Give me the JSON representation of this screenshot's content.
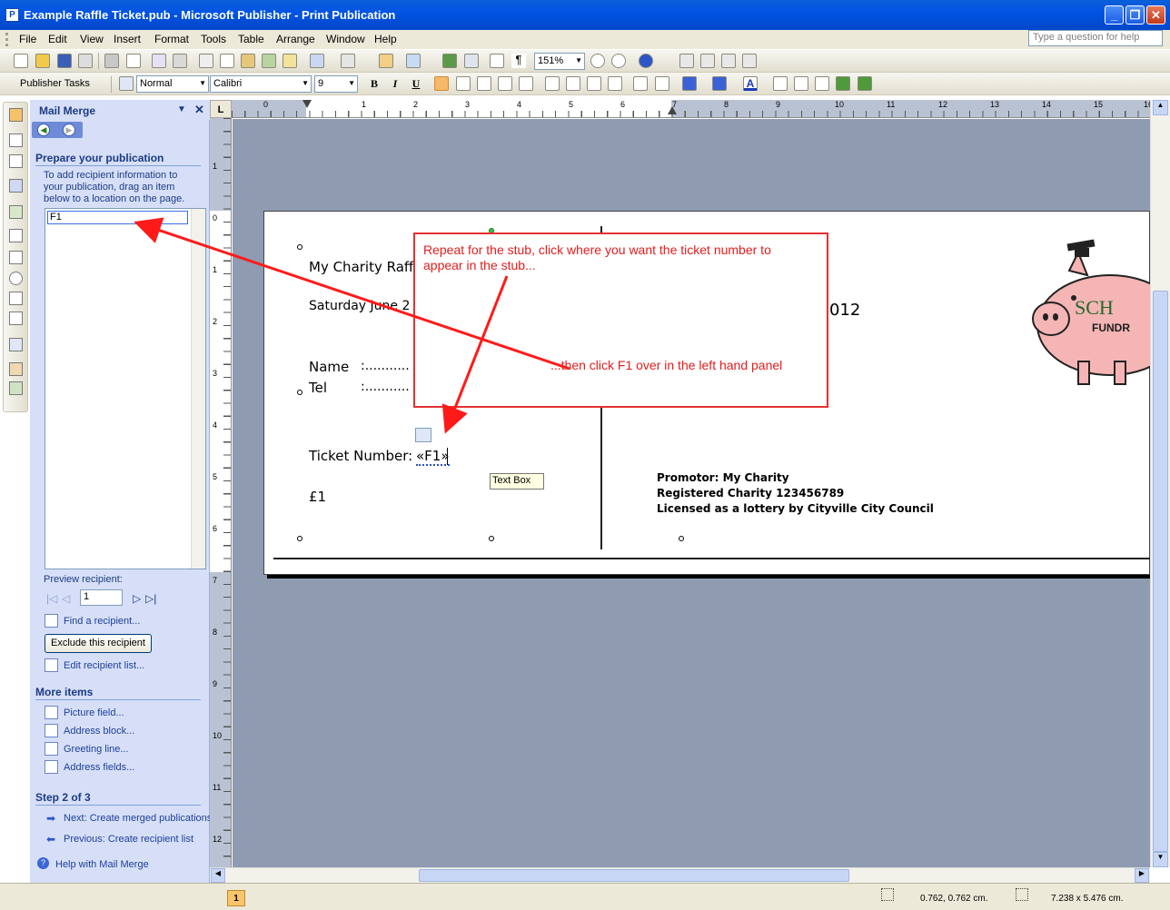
{
  "window": {
    "title": "Example Raffle Ticket.pub - Microsoft Publisher - Print Publication"
  },
  "menu": [
    "File",
    "Edit",
    "View",
    "Insert",
    "Format",
    "Tools",
    "Table",
    "Arrange",
    "Window",
    "Help"
  ],
  "ask_placeholder": "Type a question for help",
  "toolbar": {
    "zoom": "151%",
    "publisher_tasks": "Publisher Tasks",
    "style": "Normal",
    "font": "Calibri",
    "size": "9"
  },
  "pane": {
    "title": "Mail Merge",
    "section_prepare": "Prepare your publication",
    "instructions": "To add recipient information to your publication, drag an item below to a location on the page.",
    "fields": [
      "F1"
    ],
    "preview_label": "Preview recipient:",
    "preview_value": "1",
    "find_recipient": "Find a recipient...",
    "exclude_button": "Exclude this recipient",
    "edit_list": "Edit recipient list...",
    "more_items": "More items",
    "picture_field": "Picture field...",
    "address_block": "Address block...",
    "greeting_line": "Greeting line...",
    "address_fields": "Address fields...",
    "step": "Step 2 of 3",
    "next": "Next: Create merged publications",
    "previous": "Previous: Create recipient list",
    "help": "Help with Mail Merge"
  },
  "ruler": {
    "h": [
      "0",
      "1",
      "2",
      "3",
      "4",
      "5",
      "6",
      "7",
      "8",
      "9",
      "10",
      "11",
      "12",
      "13",
      "14",
      "15",
      "16"
    ],
    "v": [
      "1",
      "0",
      "1",
      "2",
      "3",
      "4",
      "5",
      "6",
      "7",
      "8",
      "9",
      "10",
      "11",
      "12"
    ]
  },
  "ticket": {
    "stub_title": "My Charity Raff",
    "stub_date": "Saturday June 2",
    "name_label": "Name",
    "name_dots": ":...........",
    "tel_label": "Tel",
    "tel_dots": ":...........",
    "ticket_number_label": "Ticket Number:",
    "field_code": "«F1»",
    "price": "£1",
    "date_fragment": "012",
    "promoter": "Promotor: My Charity",
    "registered": "Registered Charity 123456789",
    "licensed": "Licensed as a lottery by Cityville City Council",
    "logo_text_1": "SCH",
    "logo_text_2": "FUNDR",
    "tooltip": "Text Box"
  },
  "callout": {
    "line1": "Repeat for the stub, click where you want the ticket number to appear in the stub...",
    "line2": "...then click F1 over in the left hand panel"
  },
  "status": {
    "page": "1",
    "position": "0.762, 0.762 cm.",
    "size": "7.238 x  5.476 cm."
  },
  "colors": {
    "annotation": "#e41c1c",
    "pane_bg": "#d6dff7",
    "titlebar": "#0054e3"
  }
}
